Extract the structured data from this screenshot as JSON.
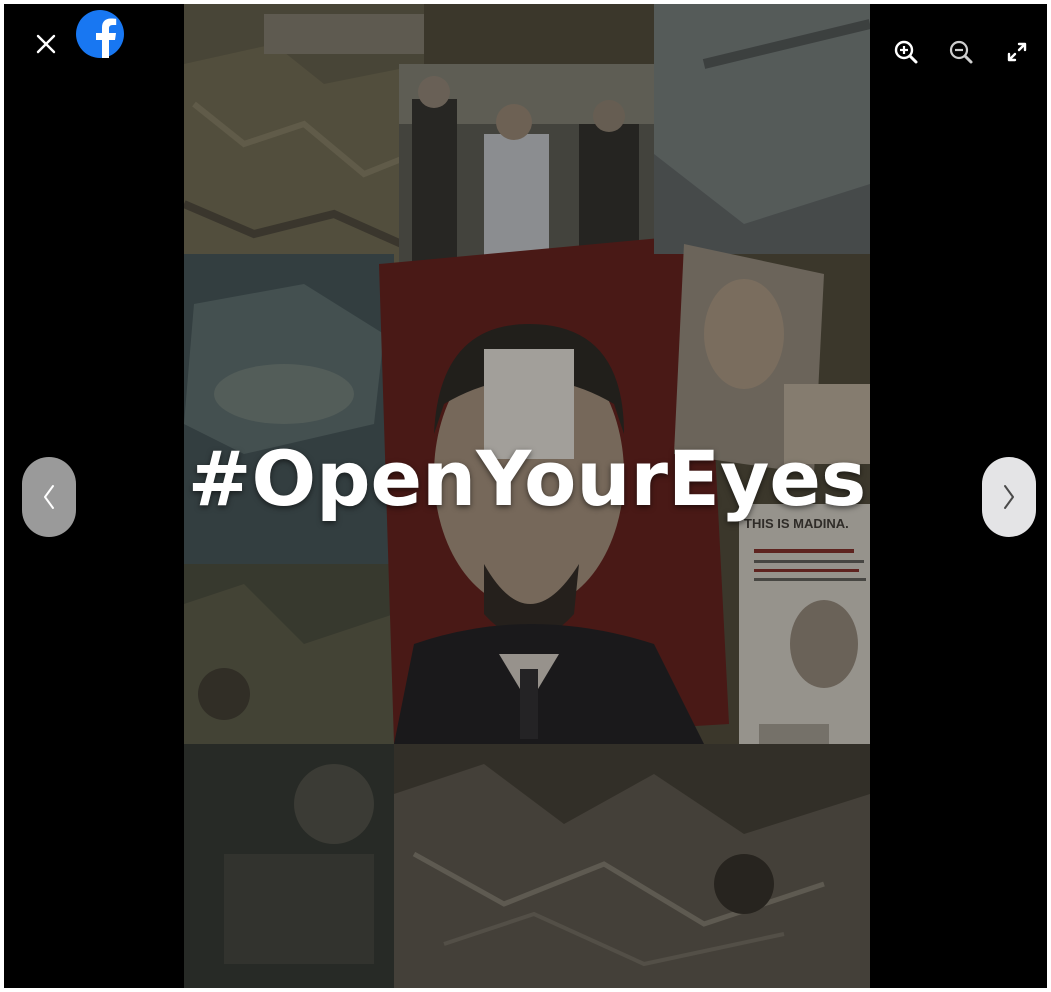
{
  "app": {
    "brand": "facebook",
    "brand_color": "#1877F2"
  },
  "toolbar": {
    "close_icon": "close-icon",
    "zoom_in_icon": "zoom-in-icon",
    "zoom_out_icon": "zoom-out-icon",
    "fullscreen_icon": "expand-icon"
  },
  "navigation": {
    "previous_icon": "chevron-left-icon",
    "next_icon": "chevron-right-icon"
  },
  "photo": {
    "overlay_text": "#OpenYourEyes",
    "poster_caption_heading": "THIS IS MADINA."
  },
  "colors": {
    "background": "#000000",
    "overlay_text": "#FFFFFF",
    "prev_button": "#9A9A9A",
    "next_button": "#E4E4E6"
  }
}
